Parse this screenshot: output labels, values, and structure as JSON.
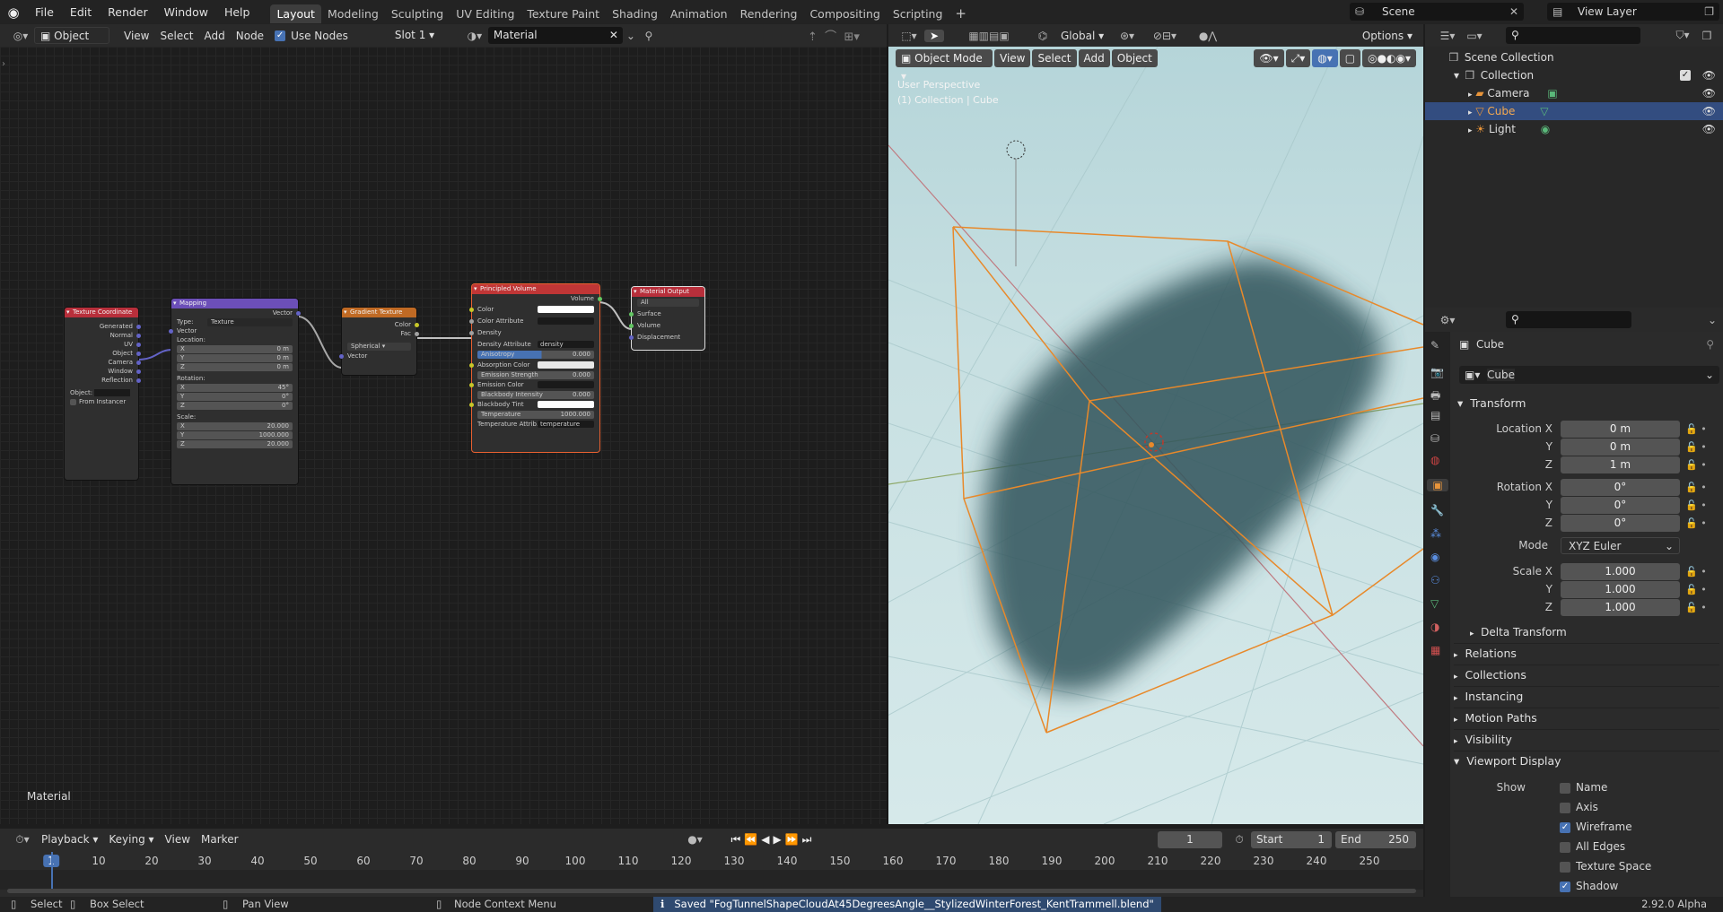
{
  "topbar": {
    "menus": [
      "File",
      "Edit",
      "Render",
      "Window",
      "Help"
    ],
    "workspaces": [
      "Layout",
      "Modeling",
      "Sculpting",
      "UV Editing",
      "Texture Paint",
      "Shading",
      "Animation",
      "Rendering",
      "Compositing",
      "Scripting"
    ],
    "add_tab": "+",
    "scene": "Scene",
    "view_layer": "View Layer"
  },
  "node_header": {
    "object_type": "Object",
    "menus": [
      "View",
      "Select",
      "Add",
      "Node"
    ],
    "use_nodes": "Use Nodes",
    "slot": "Slot 1",
    "material": "Material"
  },
  "nodes": {
    "texcoord": {
      "title": "Texture Coordinate",
      "outputs": [
        "Generated",
        "Normal",
        "UV",
        "Object",
        "Camera",
        "Window",
        "Reflection"
      ],
      "object_label": "Object:",
      "from_instancer": "From Instancer"
    },
    "mapping": {
      "title": "Mapping",
      "out": "Vector",
      "type_label": "Type:",
      "type_value": "Texture",
      "in_vector": "Vector",
      "location": "Location:",
      "rotation": "Rotation:",
      "scale": "Scale:",
      "loc": [
        [
          "X",
          "0 m"
        ],
        [
          "Y",
          "0 m"
        ],
        [
          "Z",
          "0 m"
        ]
      ],
      "rot": [
        [
          "X",
          "45°"
        ],
        [
          "Y",
          "0°"
        ],
        [
          "Z",
          "0°"
        ]
      ],
      "scl": [
        [
          "X",
          "20.000"
        ],
        [
          "Y",
          "1000.000"
        ],
        [
          "Z",
          "20.000"
        ]
      ]
    },
    "gradient": {
      "title": "Gradient Texture",
      "outputs": [
        "Color",
        "Fac"
      ],
      "type": "Spherical",
      "in": "Vector"
    },
    "volume": {
      "title": "Principled Volume",
      "out": "Volume",
      "color": "Color",
      "color_attr": "Color Attribute",
      "density": "Density",
      "density_attr": "Density Attribute",
      "density_attr_val": "density",
      "anisotropy": "Anisotropy",
      "anisotropy_val": "0.000",
      "absorption": "Absorption Color",
      "emission_strength": "Emission Strength",
      "emission_strength_val": "0.000",
      "emission_color": "Emission Color",
      "blackbody_int": "Blackbody Intensity",
      "blackbody_int_val": "0.000",
      "blackbody_tint": "Blackbody Tint",
      "temperature": "Temperature",
      "temperature_val": "1000.000",
      "temp_attr": "Temperature Attrib...",
      "temp_attr_val": "temperature"
    },
    "output": {
      "title": "Material Output",
      "target": "All",
      "inputs": [
        "Surface",
        "Volume",
        "Displacement"
      ]
    }
  },
  "node_editor_label": "Material",
  "viewport": {
    "mode": "Object Mode",
    "menus": [
      "View",
      "Select",
      "Add",
      "Object"
    ],
    "transform": "Global",
    "options": "Options",
    "overlay1": "User Perspective",
    "overlay2": "(1) Collection | Cube"
  },
  "outliner": {
    "root": "Scene Collection",
    "collection": "Collection",
    "items": [
      "Camera",
      "Cube",
      "Light"
    ]
  },
  "properties": {
    "object_name": "Cube",
    "data_name": "Cube",
    "transform": "Transform",
    "loc_labels": [
      "Location X",
      "Y",
      "Z"
    ],
    "loc_vals": [
      "0 m",
      "0 m",
      "1 m"
    ],
    "rot_labels": [
      "Rotation X",
      "Y",
      "Z"
    ],
    "rot_vals": [
      "0°",
      "0°",
      "0°"
    ],
    "mode_label": "Mode",
    "mode_val": "XYZ Euler",
    "scale_labels": [
      "Scale X",
      "Y",
      "Z"
    ],
    "scale_vals": [
      "1.000",
      "1.000",
      "1.000"
    ],
    "delta": "Delta Transform",
    "panels": [
      "Relations",
      "Collections",
      "Instancing",
      "Motion Paths",
      "Visibility",
      "Viewport Display"
    ],
    "show_label": "Show",
    "show_items": [
      [
        "Name",
        false
      ],
      [
        "Axis",
        false
      ],
      [
        "Wireframe",
        true
      ],
      [
        "All Edges",
        false
      ],
      [
        "Texture Space",
        false
      ],
      [
        "Shadow",
        true
      ]
    ]
  },
  "timeline": {
    "menus": [
      "Playback",
      "Keying",
      "View",
      "Marker"
    ],
    "current": "1",
    "start_label": "Start",
    "start": "1",
    "end_label": "End",
    "end": "250",
    "ticks": [
      "1",
      "10",
      "20",
      "30",
      "40",
      "50",
      "60",
      "70",
      "80",
      "90",
      "100",
      "110",
      "120",
      "130",
      "140",
      "150",
      "160",
      "170",
      "180",
      "190",
      "200",
      "210",
      "220",
      "230",
      "240",
      "250"
    ]
  },
  "status": {
    "select": "Select",
    "box_select": "Box Select",
    "pan": "Pan View",
    "context": "Node Context Menu",
    "saved": "Saved \"FogTunnelShapeCloudAt45DegreesAngle__StylizedWinterForest_KentTrammell.blend\"",
    "version": "2.92.0 Alpha"
  },
  "colors": {
    "accent": "#4772b3",
    "selection": "#e8a040",
    "texcoord_hdr": "#b82f3b",
    "mapping_hdr": "#6c4fb8",
    "gradient_hdr": "#c06a24",
    "volume_hdr": "#c03636",
    "output_hdr": "#b82f3b"
  }
}
